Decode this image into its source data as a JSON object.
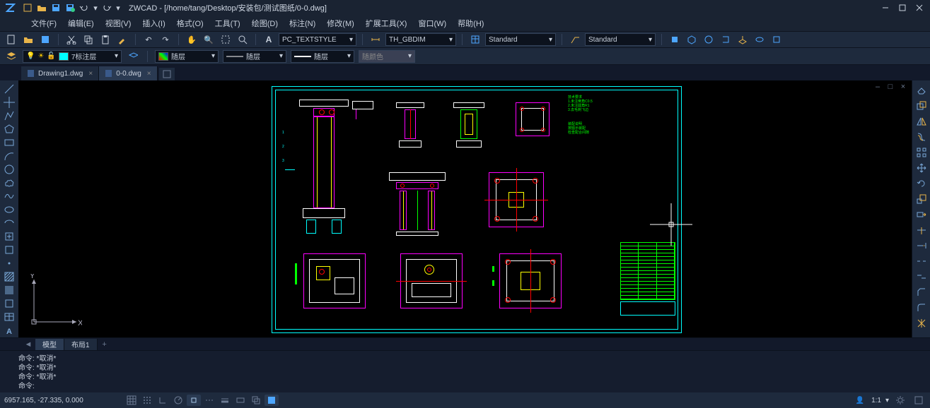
{
  "app": {
    "name": "ZWCAD",
    "title_path": "[/home/tang/Desktop/安装包/测试图纸/0-0.dwg]"
  },
  "menu": {
    "items": [
      "文件(F)",
      "编辑(E)",
      "视图(V)",
      "插入(I)",
      "格式(O)",
      "工具(T)",
      "绘图(D)",
      "标注(N)",
      "修改(M)",
      "扩展工具(X)",
      "窗口(W)",
      "帮助(H)"
    ]
  },
  "ribbon1": {
    "textstyle": "PC_TEXTSTYLE",
    "dimstyle": "TH_GBDIM",
    "tablestyle": "Standard",
    "mleaderstyle": "Standard"
  },
  "ribbon2": {
    "layer": "7标注层",
    "linetype": "随层",
    "lineweight": "随层",
    "plotstyle": "随层",
    "color_label": "随颜色"
  },
  "doctabs": {
    "tabs": [
      {
        "label": "Drawing1.dwg",
        "active": false
      },
      {
        "label": "0-0.dwg",
        "active": true
      }
    ]
  },
  "layouttabs": {
    "tabs": [
      {
        "label": "模型",
        "active": true
      },
      {
        "label": "布局1",
        "active": false
      }
    ]
  },
  "command": {
    "history": [
      "命令: *取消*",
      "命令: *取消*",
      "命令: *取消*"
    ],
    "prompt": "命令:"
  },
  "status": {
    "coords": "6957.165, -27.335, 0.000",
    "zoom": "1:1",
    "ucs_x": "X",
    "ucs_y": "Y"
  },
  "icons": {
    "chevron_down": "▾",
    "close_x": "×",
    "plus": "+",
    "person": "👤"
  }
}
